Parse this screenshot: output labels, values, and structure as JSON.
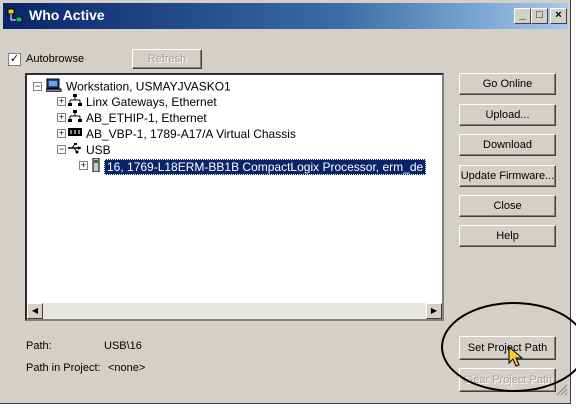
{
  "window": {
    "title": "Who Active"
  },
  "titlebar_buttons": {
    "minimize": "_",
    "maximize": "□",
    "close": "×"
  },
  "autobrowse": {
    "label": "Autobrowse",
    "checked": true,
    "check_mark": "✓"
  },
  "refresh_label": "Refresh",
  "tree": {
    "root": "Workstation, USMAYJVASKO1",
    "items": [
      "Linx Gateways, Ethernet",
      "AB_ETHIP-1, Ethernet",
      "AB_VBP-1, 1789-A17/A Virtual Chassis",
      "USB"
    ],
    "usb_child": "16, 1769-L18ERM-BB1B CompactLogix Processor, erm_de"
  },
  "buttons": {
    "go_online": "Go Online",
    "upload": "Upload...",
    "download": "Download",
    "update_firmware": "Update Firmware...",
    "close": "Close",
    "help": "Help",
    "set_project_path": "Set Project Path",
    "clear_project_path": "Clear Project Path"
  },
  "path": {
    "label": "Path:",
    "value": "USB\\16"
  },
  "path_in_project": {
    "label": "Path in Project:",
    "value": "<none>"
  },
  "scroll_arrows": {
    "left": "◀",
    "right": "▶"
  }
}
